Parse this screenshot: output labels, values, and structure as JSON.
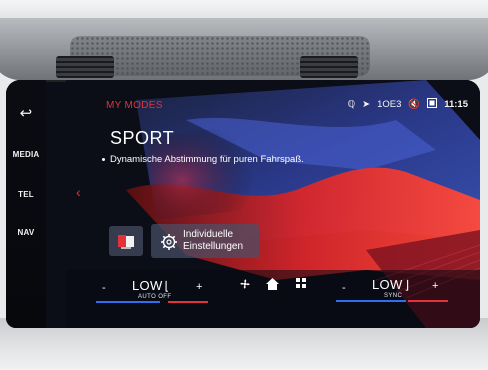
{
  "rail": {
    "back_glyph": "↩",
    "items": [
      "MEDIA",
      "TEL",
      "NAV"
    ]
  },
  "header": {
    "title": "MY MODES",
    "status": {
      "signal": "ℚ",
      "nav": "➤",
      "odometer": "1OE3",
      "mute": "🔇",
      "clock": "11:15"
    }
  },
  "mode": {
    "name": "SPORT",
    "description": "Dynamische Abstimmung für puren Fahrspaß."
  },
  "buttons": {
    "individual_line1": "Individuelle",
    "individual_line2": "Einstellungen"
  },
  "climate": {
    "left": {
      "minus": "-",
      "value": "LOW",
      "seat_glyph": "⌊",
      "sub": "AUTO OFF",
      "plus": "+"
    },
    "right": {
      "minus": "-",
      "value": "LOW",
      "seat_glyph": "⌋",
      "sub": "SYNC",
      "plus": "+"
    }
  },
  "center_icons": [
    "fan-icon",
    "home-icon",
    "grid-icon"
  ],
  "colors": {
    "accent_red": "#e2323c",
    "blue_line": "#2f6ef0",
    "red_line": "#e2323c"
  }
}
